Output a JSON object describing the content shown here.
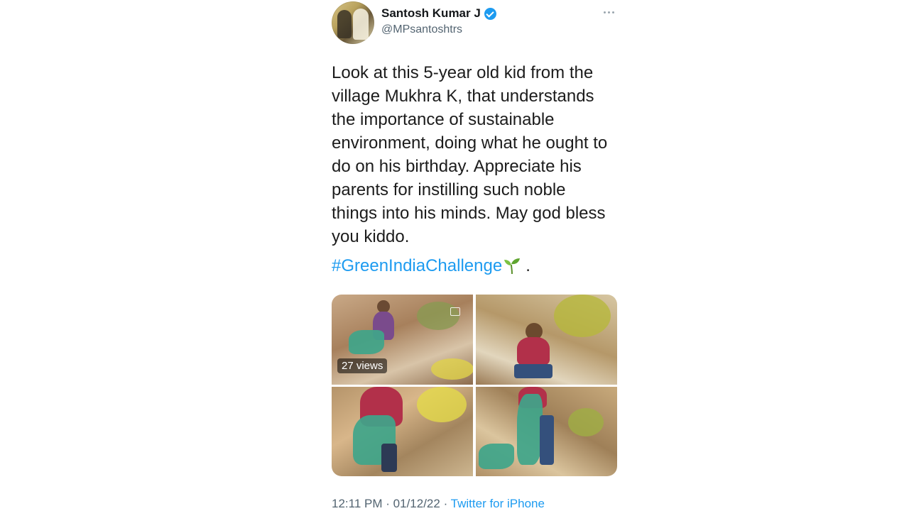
{
  "author": {
    "display_name": "Santosh Kumar J",
    "handle": "@MPsantoshtrs",
    "verified_color": "#1d9bf0"
  },
  "tweet": {
    "body_lines": [
      "Look at this 5-year old kid from the",
      "village Mukhra K, that understands",
      "the importance of sustainable",
      "environment, doing what he ought to",
      "do on his birthday. Appreciate his",
      "parents for instilling such noble",
      "things into his minds. May god bless",
      "you kiddo."
    ],
    "hashtag": "#GreenIndiaChallenge",
    "hashtag_emoji": "sprout-icon",
    "hashtag_suffix": ".",
    "link_color": "#1d9bf0"
  },
  "media": {
    "views": "27 views",
    "photo_count": 4
  },
  "meta": {
    "time": "12:11 PM",
    "date": "01/12/22",
    "separator": "·",
    "source": "Twitter for iPhone"
  }
}
